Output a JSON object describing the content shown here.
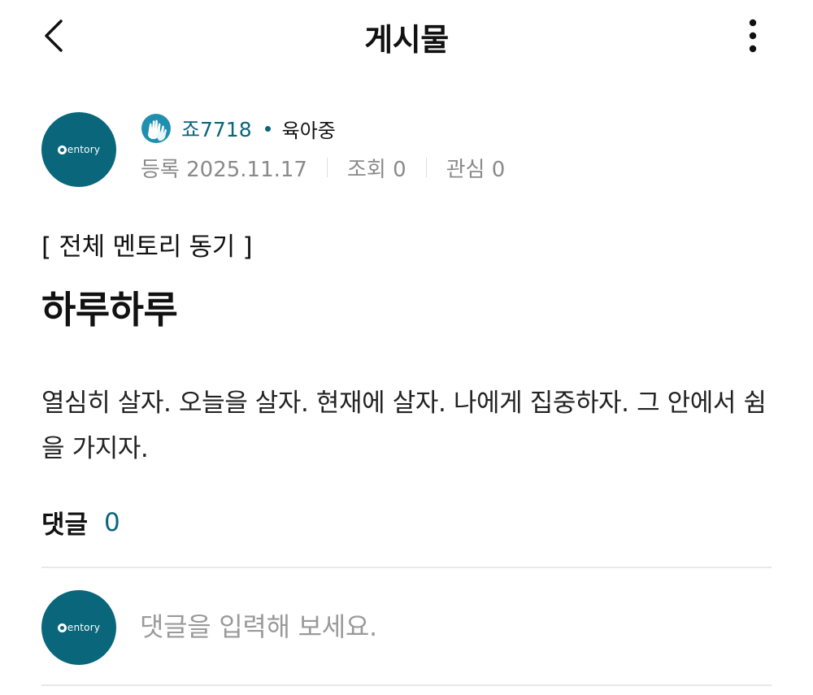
{
  "header": {
    "title": "게시물"
  },
  "author": {
    "avatar_text": "entory",
    "name": "죠7718",
    "status": "육아중"
  },
  "meta": {
    "registered": "등록 2025.11.17",
    "views": "조회 0",
    "interest": "관심 0"
  },
  "post": {
    "category": "[ 전체 멘토리 동기 ]",
    "title": "하루하루",
    "body": "열심히 살자. 오늘을 살자. 현재에 살자. 나에게 집중하자. 그 안에서 쉼을 가지자."
  },
  "comments": {
    "label": "댓글",
    "count": "0",
    "avatar_text": "entory",
    "input_placeholder": "댓글을 입력해 보세요."
  },
  "colors": {
    "accent": "#0a667a",
    "meta_text": "#8a8a8a",
    "divider": "#e8e8e8"
  },
  "icons": {
    "back": "chevron-left-icon",
    "more": "more-vertical-icon",
    "badge": "hands-badge-icon"
  }
}
